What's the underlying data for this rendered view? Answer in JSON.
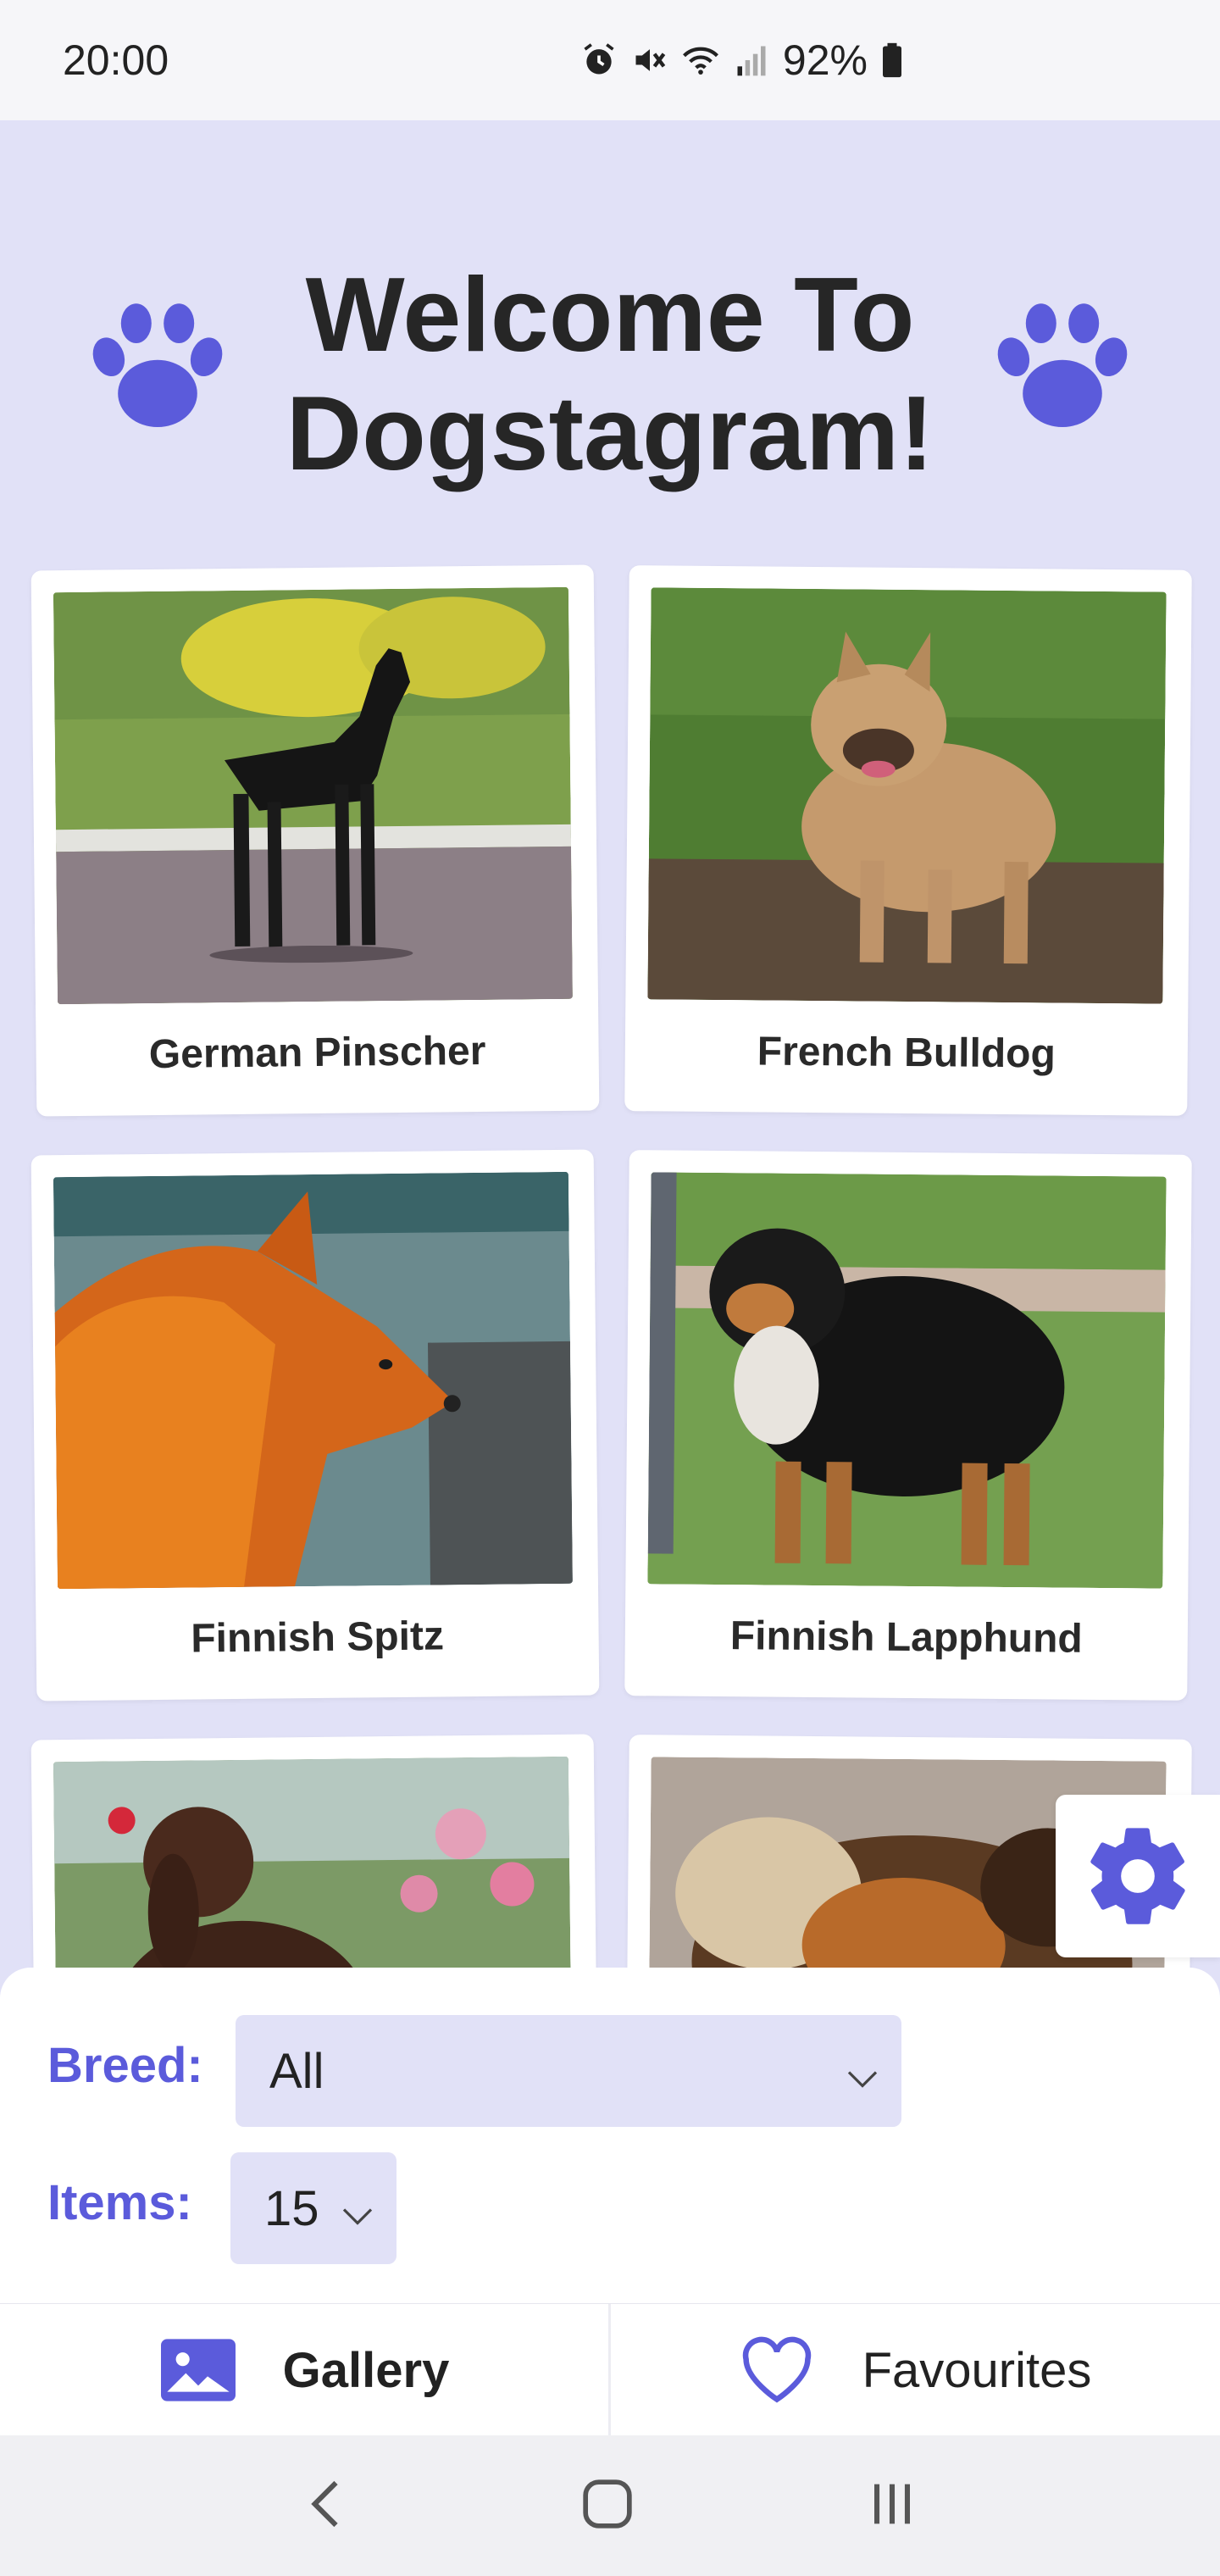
{
  "status_bar": {
    "time": "20:00",
    "battery": "92%",
    "icons": [
      "alarm-icon",
      "mute-icon",
      "wifi-icon",
      "signal-icon",
      "battery-icon"
    ]
  },
  "header": {
    "title_line1": "Welcome To",
    "title_line2": "Dogstagram!",
    "icons": [
      "paw-icon",
      "paw-icon"
    ]
  },
  "colors": {
    "accent": "#5b5bdb",
    "background": "#e1e1f7"
  },
  "gallery": {
    "cards": [
      {
        "label": "German Pinscher"
      },
      {
        "label": "French Bulldog"
      },
      {
        "label": "Finnish Spitz"
      },
      {
        "label": "Finnish Lapphund"
      },
      {
        "label": ""
      },
      {
        "label": ""
      }
    ]
  },
  "filters": {
    "breed_label": "Breed:",
    "breed_value": "All",
    "items_label": "Items:",
    "items_value": "15"
  },
  "tabs": {
    "gallery": "Gallery",
    "favourites": "Favourites"
  },
  "nav_bar": {
    "icons": [
      "back-icon",
      "home-icon",
      "recents-icon"
    ]
  }
}
